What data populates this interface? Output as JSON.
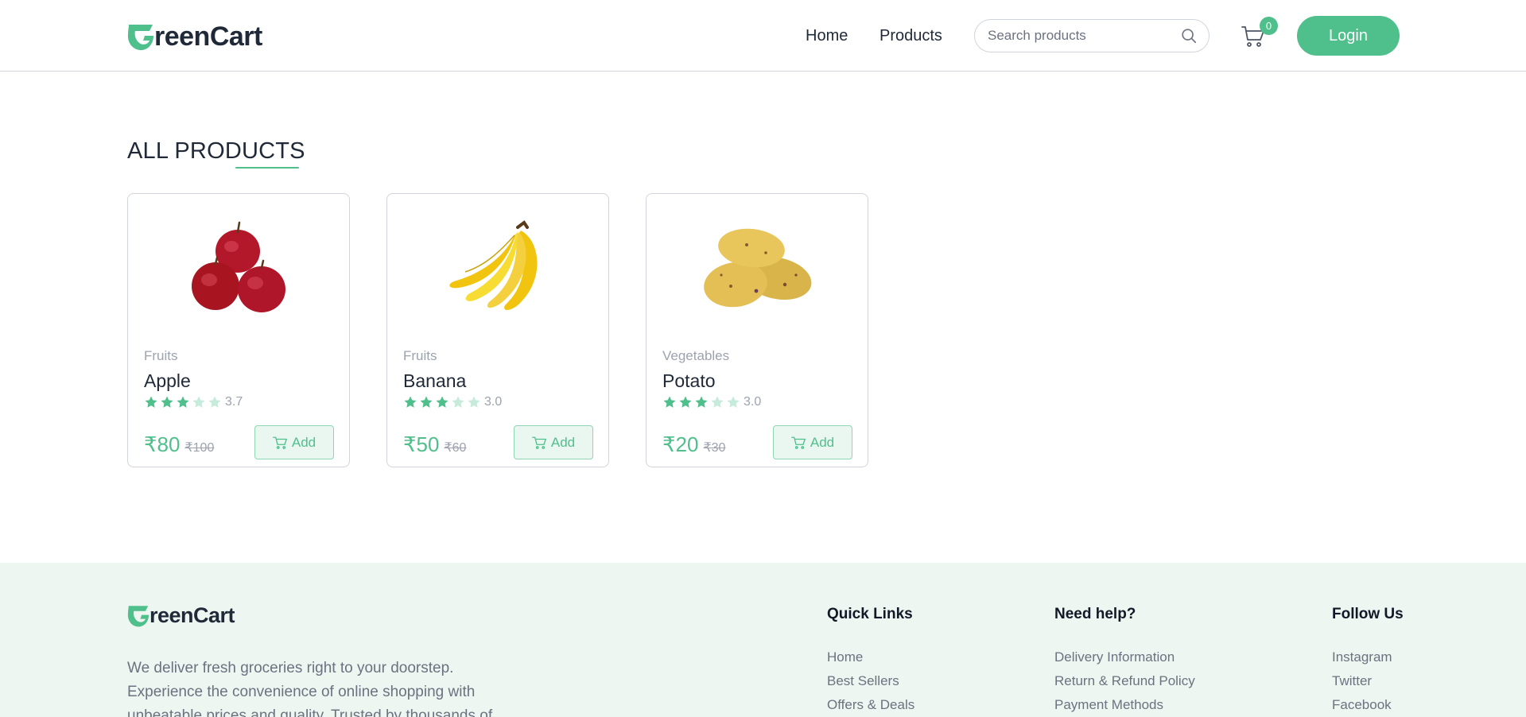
{
  "brand": {
    "logo_text": "reenCart",
    "accent": "#4fbf8b"
  },
  "header": {
    "nav": [
      {
        "label": "Home"
      },
      {
        "label": "Products"
      }
    ],
    "search_placeholder": "Search products",
    "cart_count": "0",
    "login_label": "Login"
  },
  "main": {
    "section_title": "ALL PRODUCTS",
    "products": [
      {
        "category": "Fruits",
        "name": "Apple",
        "rating": "3.7",
        "stars": 3,
        "price": "₹80",
        "mrp": "₹100",
        "add_label": "Add",
        "image": "apple"
      },
      {
        "category": "Fruits",
        "name": "Banana",
        "rating": "3.0",
        "stars": 3,
        "price": "₹50",
        "mrp": "₹60",
        "add_label": "Add",
        "image": "banana"
      },
      {
        "category": "Vegetables",
        "name": "Potato",
        "rating": "3.0",
        "stars": 3,
        "price": "₹20",
        "mrp": "₹30",
        "add_label": "Add",
        "image": "potato"
      }
    ]
  },
  "footer": {
    "description": "We deliver fresh groceries right to your doorstep. Experience the convenience of online shopping with unbeatable prices and quality. Trusted by thousands of",
    "columns": [
      {
        "title": "Quick Links",
        "links": [
          "Home",
          "Best Sellers",
          "Offers & Deals"
        ]
      },
      {
        "title": "Need help?",
        "links": [
          "Delivery Information",
          "Return & Refund Policy",
          "Payment Methods"
        ]
      },
      {
        "title": "Follow Us",
        "links": [
          "Instagram",
          "Twitter",
          "Facebook"
        ]
      }
    ]
  }
}
